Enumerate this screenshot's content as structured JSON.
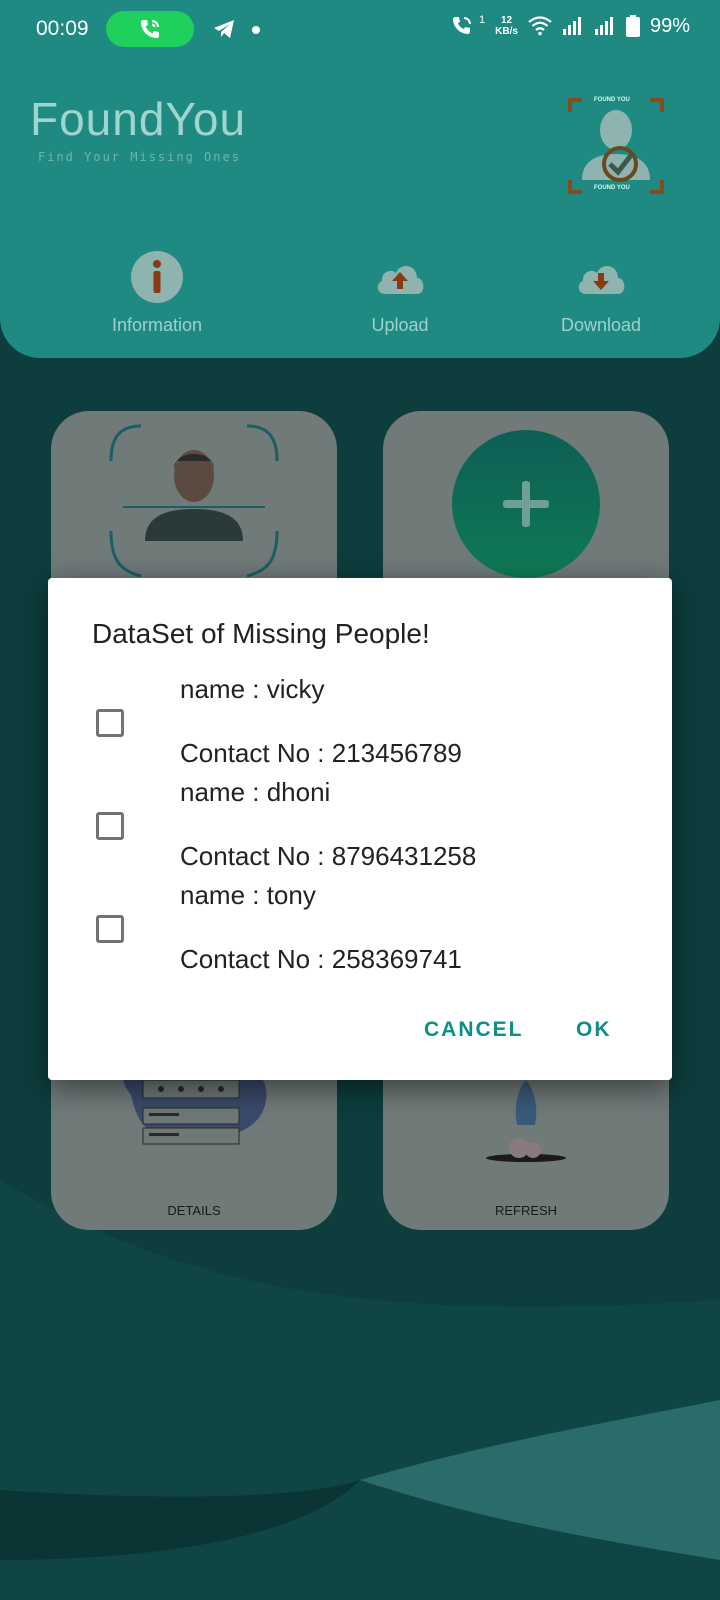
{
  "status_bar": {
    "time": "00:09",
    "call_icon": "phone-call-icon",
    "telegram_icon": "telegram-icon",
    "speed_value": "12",
    "speed_unit": "KB/s",
    "battery": "99%",
    "signal_label": "1"
  },
  "app": {
    "title": "FoundYou",
    "subtitle": "Find Your Missing Ones",
    "logo_top_text": "FOUND YOU",
    "logo_bottom_text": "FOUND YOU",
    "nav": [
      {
        "label": "Information",
        "icon": "info-icon"
      },
      {
        "label": "Upload",
        "icon": "cloud-upload-icon"
      },
      {
        "label": "Download",
        "icon": "cloud-download-icon"
      }
    ],
    "cards": [
      {
        "label": "DETAILS"
      },
      {
        "label": "REFRESH"
      }
    ]
  },
  "dialog": {
    "title": "DataSet of Missing People!",
    "items": [
      {
        "name": "name : vicky",
        "contact": "Contact No : 213456789"
      },
      {
        "name": "name : dhoni",
        "contact": "Contact No : 8796431258"
      },
      {
        "name": "name : tony",
        "contact": "Contact No : 258369741"
      }
    ],
    "cancel_label": "CANCEL",
    "ok_label": "OK"
  },
  "colors": {
    "accent": "#0f8e86",
    "header": "#1e8a82",
    "call_pill": "#1fd05c"
  }
}
